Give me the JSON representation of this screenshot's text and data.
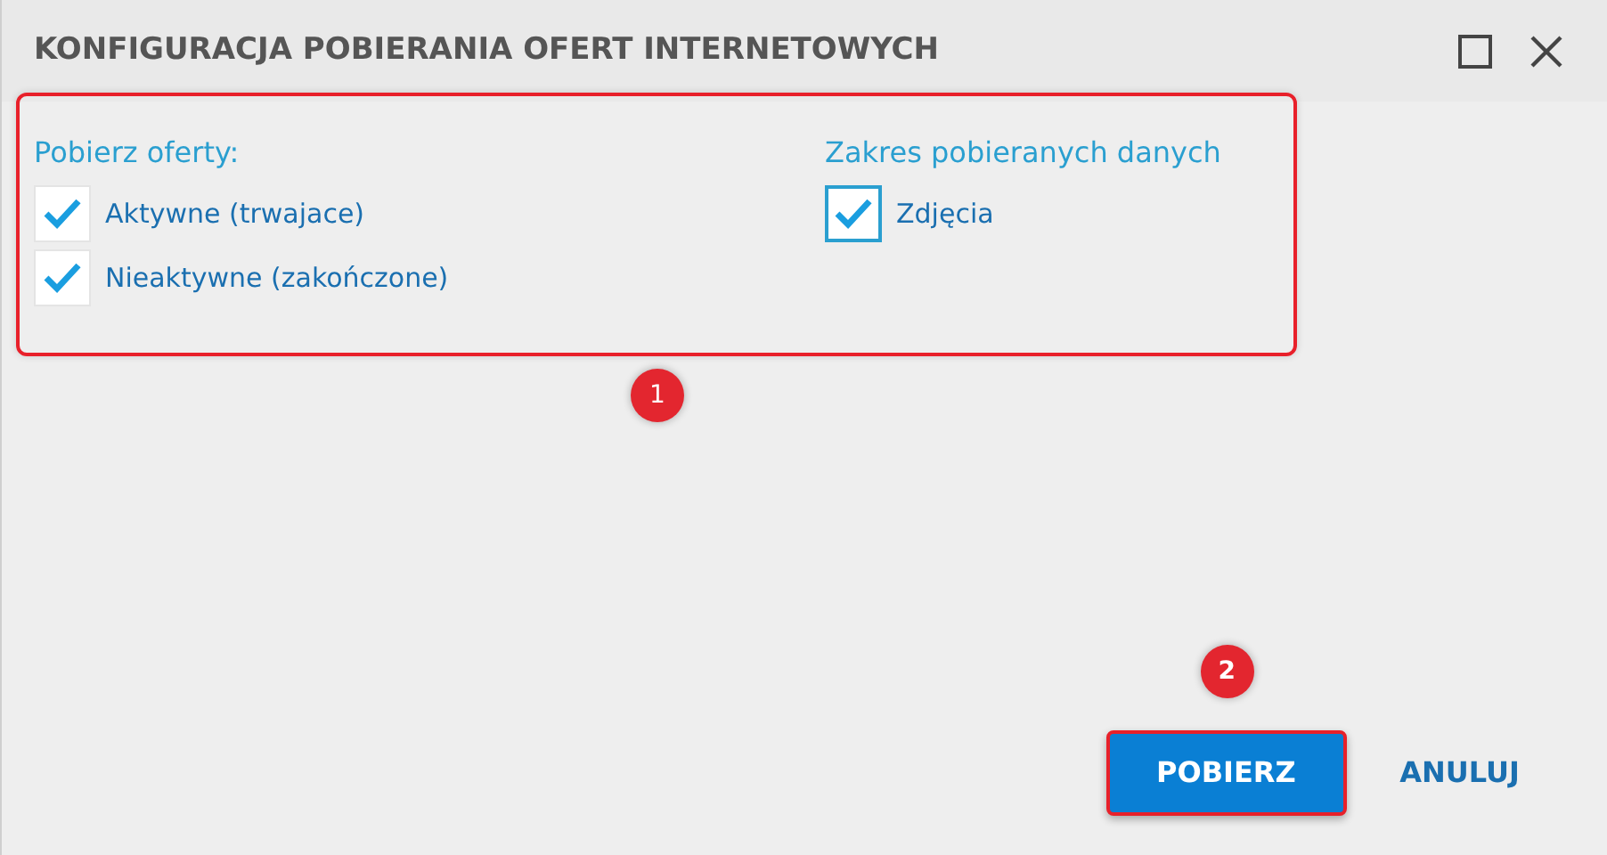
{
  "window": {
    "title": "KONFIGURACJA POBIERANIA OFERT INTERNETOWYCH"
  },
  "options": {
    "callout": "1",
    "groups": [
      {
        "heading": "Pobierz oferty:",
        "items": [
          {
            "label": "Aktywne (trwajace)",
            "checked": true,
            "focused": false
          },
          {
            "label": "Nieaktywne (zakończone)",
            "checked": true,
            "focused": false
          }
        ]
      },
      {
        "heading": "Zakres pobieranych danych",
        "items": [
          {
            "label": "Zdjęcia",
            "checked": true,
            "focused": true
          }
        ]
      }
    ]
  },
  "buttons": [
    {
      "label": "POBIERZ",
      "kind": "primary",
      "callout": "2"
    },
    {
      "label": "ANULUJ",
      "kind": "link"
    }
  ]
}
